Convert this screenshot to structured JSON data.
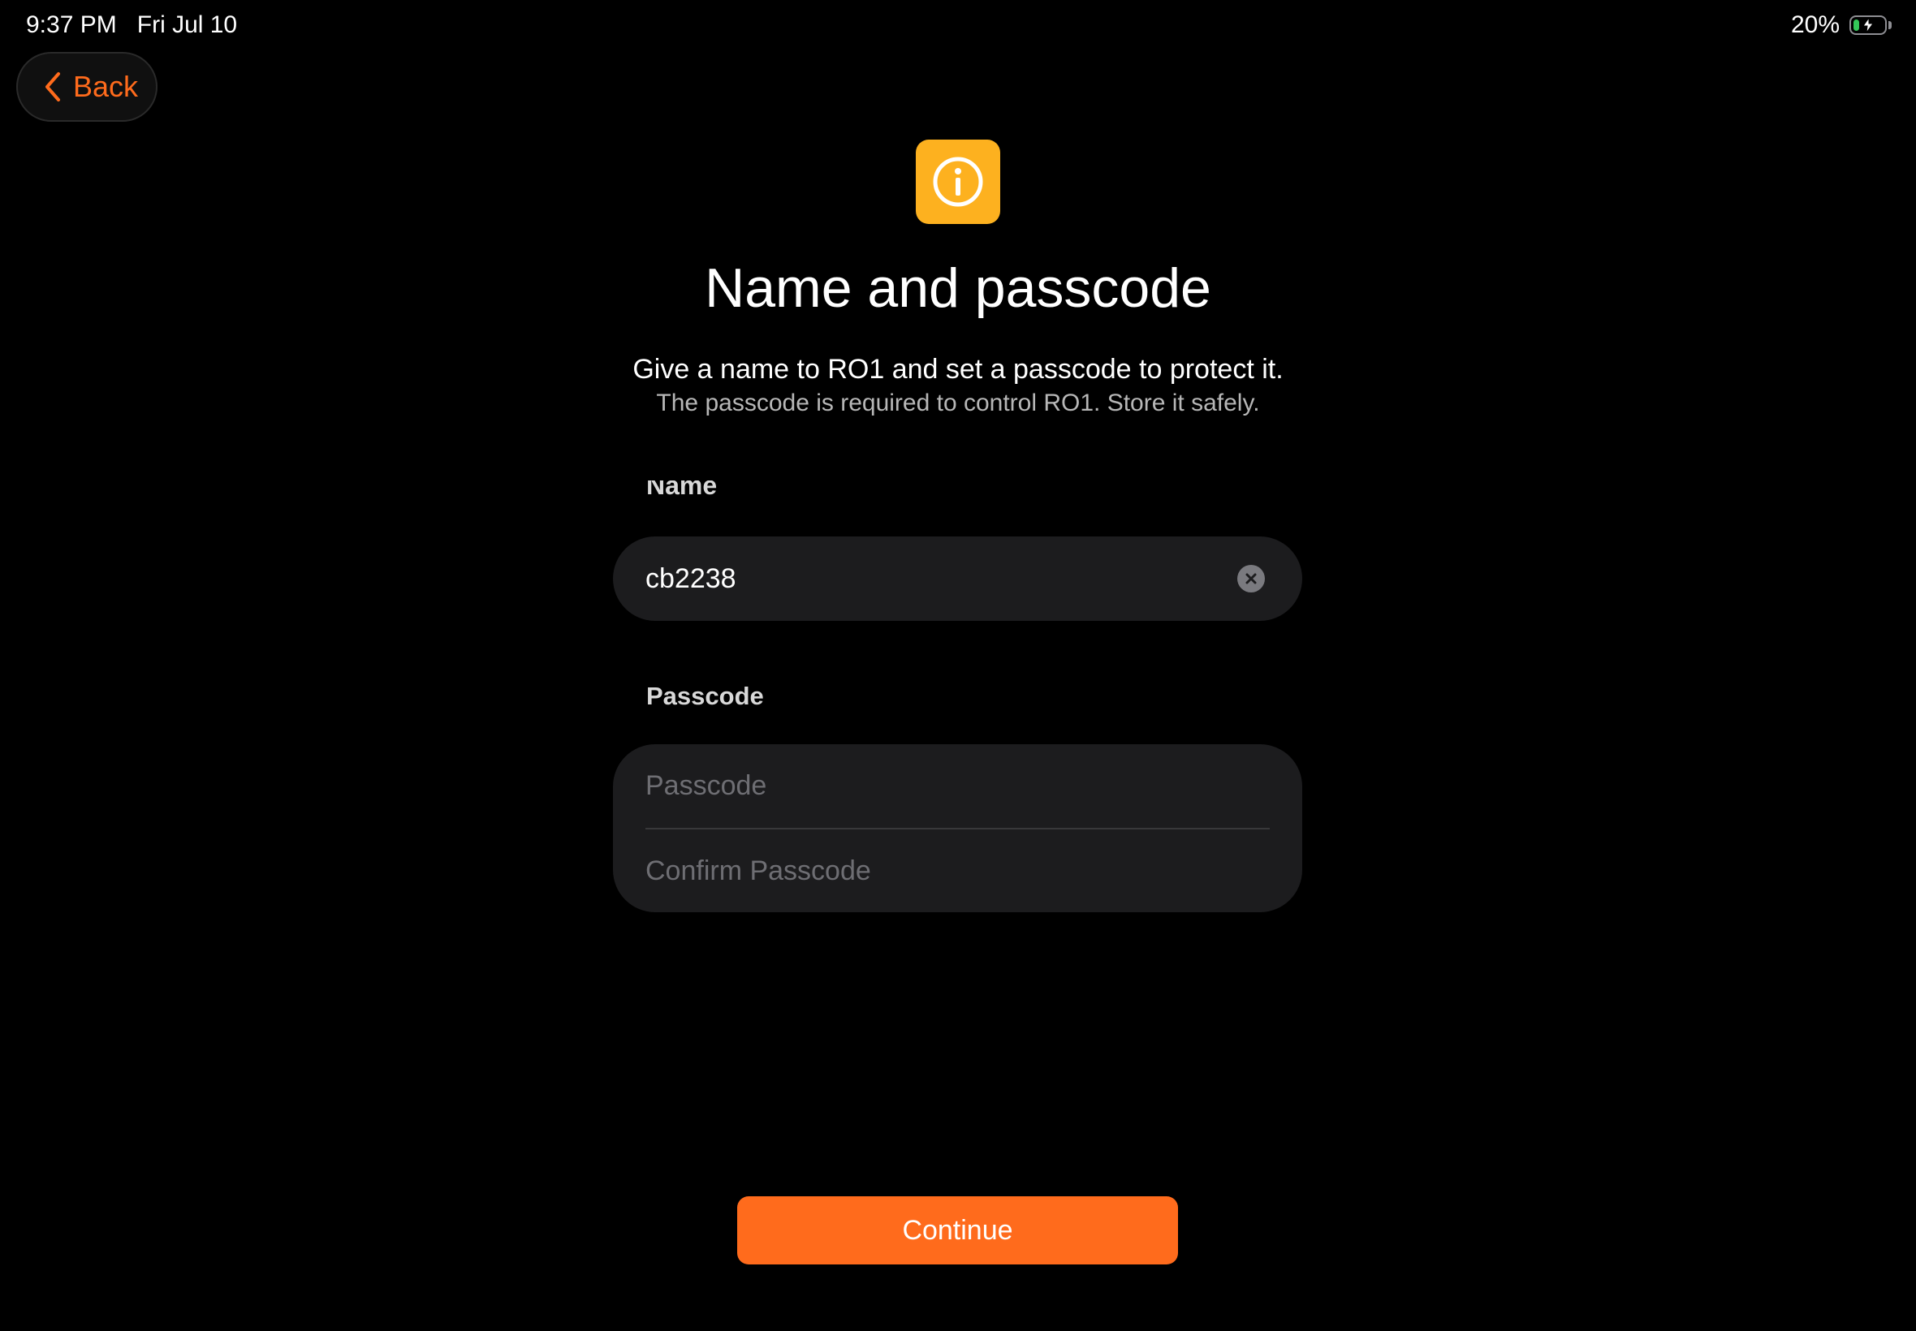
{
  "status_bar": {
    "time": "9:37 PM",
    "date": "Fri Jul 10",
    "battery_percent": "20%",
    "battery_level": 0.2,
    "charging": true
  },
  "nav": {
    "back_label": "Back",
    "back_icon": "chevron-left-icon"
  },
  "header": {
    "icon": "info-icon",
    "icon_color": "#fdb11f",
    "title": "Name and passcode",
    "subtitle": "Give a name to RO1 and set a passcode to protect it.",
    "note": "The passcode is required to control RO1. Store it safely."
  },
  "form": {
    "name_label": "Name",
    "name_value": "cb2238",
    "clear_icon": "clear-x-icon",
    "passcode_label": "Passcode",
    "passcode_placeholder": "Passcode",
    "confirm_placeholder": "Confirm Passcode"
  },
  "actions": {
    "continue_label": "Continue",
    "accent_color": "#ff6b1c"
  }
}
